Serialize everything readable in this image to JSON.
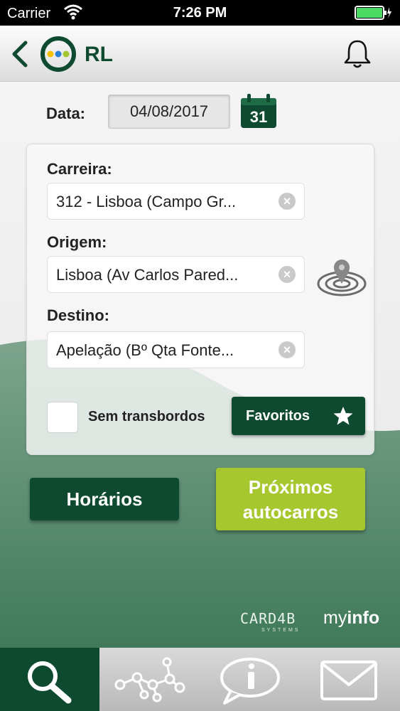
{
  "status": {
    "carrier": "Carrier",
    "time": "7:26 PM"
  },
  "header": {
    "logo_text": "RL",
    "icons": [
      "back-chevron-icon",
      "logo-icon",
      "bell-icon"
    ]
  },
  "form": {
    "date_label": "Data:",
    "date_value": "04/08/2017",
    "calendar_day": "31",
    "carreira_label": "Carreira:",
    "carreira_value": "312 - Lisboa (Campo Gr...",
    "origem_label": "Origem:",
    "origem_value": "Lisboa (Av Carlos Pared...",
    "destino_label": "Destino:",
    "destino_value": "Apelação (Bº Qta Fonte...",
    "sem_transbordos_label": "Sem transbordos",
    "favoritos_label": "Favoritos"
  },
  "actions": {
    "horarios_label": "Horários",
    "proximos_line1": "Próximos",
    "proximos_line2": "autocarros"
  },
  "footer": {
    "card4b": "CARD4B",
    "card4b_sub": "SYSTEMS",
    "myinfo_prefix": "my",
    "myinfo_suffix": "info"
  },
  "tabs": [
    {
      "icon": "search-icon",
      "active": true
    },
    {
      "icon": "network-icon",
      "active": false
    },
    {
      "icon": "info-icon",
      "active": false
    },
    {
      "icon": "mail-icon",
      "active": false
    }
  ],
  "colors": {
    "brand_green": "#0e4a30",
    "accent_lime": "#a6c72d"
  }
}
